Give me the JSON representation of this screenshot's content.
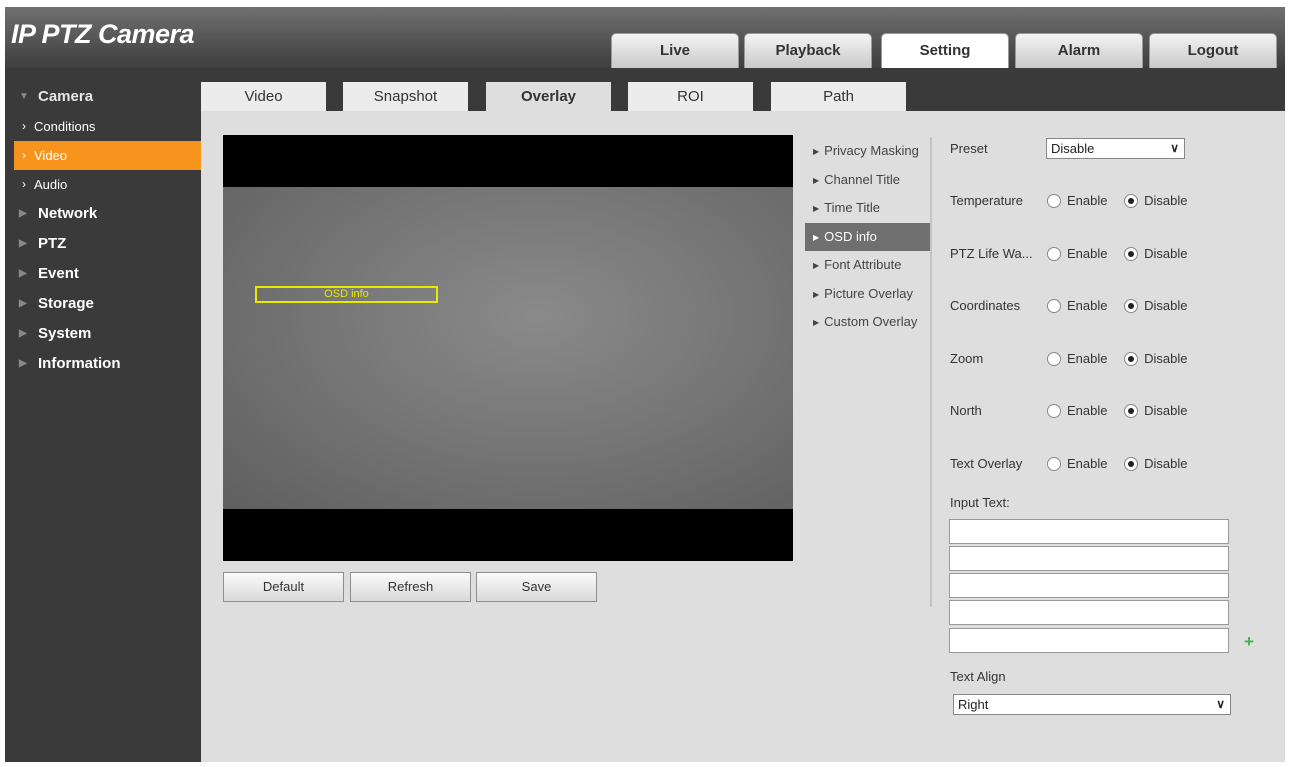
{
  "app": {
    "title": "IP PTZ Camera"
  },
  "nav": {
    "tabs": [
      {
        "label": "Live"
      },
      {
        "label": "Playback"
      },
      {
        "label": "Setting"
      },
      {
        "label": "Alarm"
      },
      {
        "label": "Logout"
      }
    ],
    "active": "Setting"
  },
  "sidebar": {
    "camera": {
      "label": "Camera"
    },
    "camera_sub": [
      {
        "label": "Conditions"
      },
      {
        "label": "Video"
      },
      {
        "label": "Audio"
      }
    ],
    "active_sub": "Video",
    "categories": [
      {
        "label": "Network"
      },
      {
        "label": "PTZ"
      },
      {
        "label": "Event"
      },
      {
        "label": "Storage"
      },
      {
        "label": "System"
      },
      {
        "label": "Information"
      }
    ]
  },
  "subtabs": {
    "items": [
      {
        "label": "Video"
      },
      {
        "label": "Snapshot"
      },
      {
        "label": "Overlay"
      },
      {
        "label": "ROI"
      },
      {
        "label": "Path"
      }
    ],
    "active": "Overlay"
  },
  "preview": {
    "osd_label": "OSD info"
  },
  "buttons": {
    "default": "Default",
    "refresh": "Refresh",
    "save": "Save"
  },
  "overlay_menu": {
    "items": [
      {
        "label": "Privacy Masking"
      },
      {
        "label": "Channel Title"
      },
      {
        "label": "Time Title"
      },
      {
        "label": "OSD info"
      },
      {
        "label": "Font Attribute"
      },
      {
        "label": "Picture Overlay"
      },
      {
        "label": "Custom Overlay"
      }
    ],
    "active": "OSD info"
  },
  "form": {
    "preset": {
      "label": "Preset",
      "value": "Disable"
    },
    "enable_label": "Enable",
    "disable_label": "Disable",
    "rows": [
      {
        "label": "Temperature",
        "value": "Disable"
      },
      {
        "label": "PTZ Life Wa...",
        "value": "Disable"
      },
      {
        "label": "Coordinates",
        "value": "Disable"
      },
      {
        "label": "Zoom",
        "value": "Disable"
      },
      {
        "label": "North",
        "value": "Disable"
      },
      {
        "label": "Text Overlay",
        "value": "Disable"
      }
    ],
    "input_text_label": "Input Text:",
    "input_texts": [
      "",
      "",
      "",
      "",
      ""
    ],
    "text_align": {
      "label": "Text Align",
      "value": "Right"
    }
  },
  "colors": {
    "accent": "#f7941d",
    "osd_box": "#e8e800",
    "add_icon": "#4caf50"
  }
}
